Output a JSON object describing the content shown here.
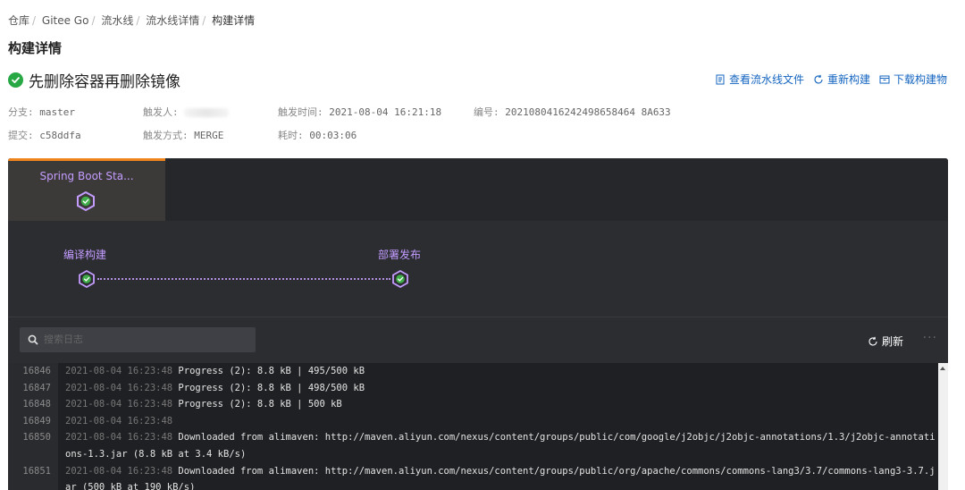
{
  "breadcrumb": [
    "仓库",
    "Gitee Go",
    "流水线",
    "流水线详情",
    "构建详情"
  ],
  "page_title": "构建详情",
  "build": {
    "name": "先删除容器再删除镜像",
    "status": "success"
  },
  "actions": {
    "view_pipeline_file": "查看流水线文件",
    "rebuild": "重新构建",
    "download_artifacts": "下载构建物"
  },
  "meta": {
    "branch_label": "分支:",
    "branch": "master",
    "trigger_user_label": "触发人:",
    "trigger_time_label": "触发时间:",
    "trigger_time": "2021-08-04 16:21:18",
    "number_label": "编号:",
    "number": "2021080416242498658464 8A633",
    "commit_label": "提交:",
    "commit": "c58ddfa",
    "trigger_mode_label": "触发方式:",
    "trigger_mode": "MERGE",
    "duration_label": "耗时:",
    "duration": "00:03:06"
  },
  "stage": {
    "label": "Spring Boot Sta..."
  },
  "jobs": [
    {
      "label": "编译构建"
    },
    {
      "label": "部署发布"
    }
  ],
  "log": {
    "search_placeholder": "搜索日志",
    "refresh_label": "刷新",
    "more_label": "···",
    "lines": [
      {
        "num": "16846",
        "ts": "2021-08-04 16:23:48",
        "text": " Progress (2): 8.8 kB | 495/500 kB"
      },
      {
        "num": "16847",
        "ts": "2021-08-04 16:23:48",
        "text": " Progress (2): 8.8 kB | 498/500 kB"
      },
      {
        "num": "16848",
        "ts": "2021-08-04 16:23:48",
        "text": " Progress (2): 8.8 kB | 500 kB"
      },
      {
        "num": "16849",
        "ts": "2021-08-04 16:23:48",
        "text": ""
      },
      {
        "num": "16850",
        "ts": "2021-08-04 16:23:48",
        "text": " Downloaded from alimaven: http://maven.aliyun.com/nexus/content/groups/public/com/google/j2objc/j2objc-annotations/1.3/j2objc-annotations-1.3.jar (8.8 kB at 3.4 kB/s)"
      },
      {
        "num": "16851",
        "ts": "2021-08-04 16:23:48",
        "text": " Downloaded from alimaven: http://maven.aliyun.com/nexus/content/groups/public/org/apache/commons/commons-lang3/3.7/commons-lang3-3.7.jar (500 kB at 190 kB/s)"
      }
    ]
  },
  "colors": {
    "success": "#28a745",
    "accent_purple": "#c39cff",
    "active_tab_border": "#f0841c",
    "link_blue": "#1565c0"
  }
}
